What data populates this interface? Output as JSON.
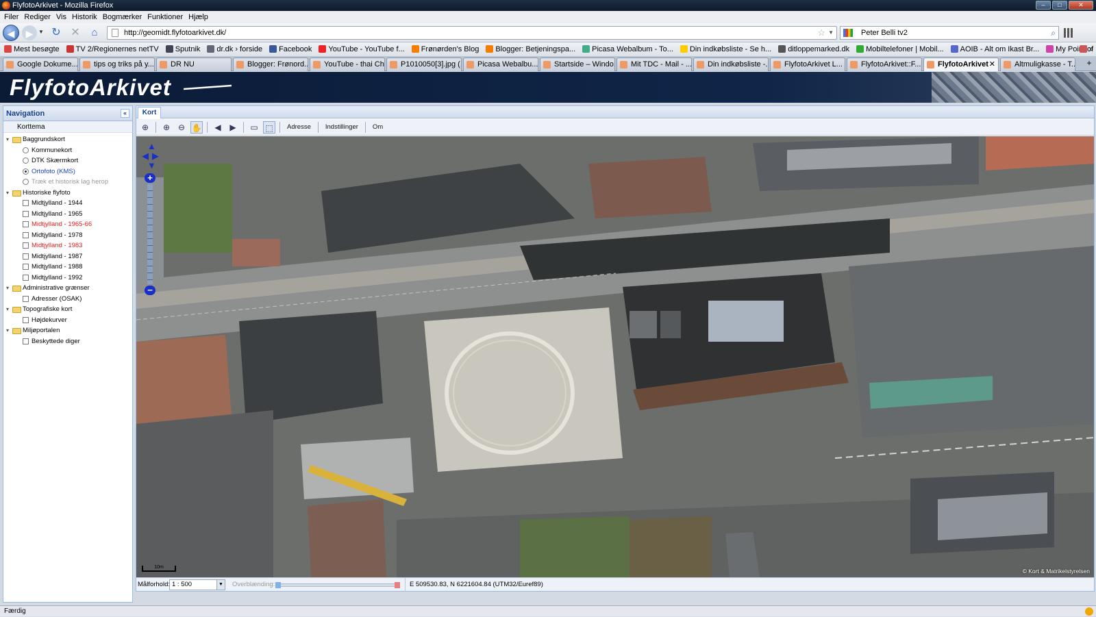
{
  "window": {
    "title": "FlyfotoArkivet - Mozilla Firefox"
  },
  "menu": [
    "Filer",
    "Rediger",
    "Vis",
    "Historik",
    "Bogmærker",
    "Funktioner",
    "Hjælp"
  ],
  "navigation": {
    "url": "http://geomidt.flyfotoarkivet.dk/",
    "search_value": "Peter Belli tv2"
  },
  "bookmarks": [
    "Mest besøgte",
    "TV 2/Regionernes netTV",
    "Sputnik",
    "dr.dk › forside",
    "Facebook",
    "YouTube - YouTube f...",
    "Frønørden's Blog",
    "Blogger: Betjeningspa...",
    "Picasa Webalbum - To...",
    "Din indkøbsliste - Se h...",
    "ditloppemarked.dk",
    "Mobiltelefoner | Mobil...",
    "AOIB - Alt om Ikast Br...",
    "My Point of Interest List"
  ],
  "tabs": [
    "Google Dokume...",
    "tips og triks på y...",
    "DR NU",
    "Blogger: Frønord...",
    "YouTube - thai Chi",
    "P1010050[3].jpg (...",
    "Picasa Webalbu...",
    "Startside – Windo...",
    "Mit TDC - Mail - ...",
    "Din indkøbsliste -...",
    "FlyfotoArkivet L...",
    "FlyfotoArkivet::F...",
    "FlyfotoArkivet",
    "Altmuligkasse - T..."
  ],
  "active_tab_index": 12,
  "site": {
    "logo": "FlyfotoArkivet"
  },
  "nav_panel": {
    "title": "Navigation",
    "korttema": "Korttema",
    "tree": [
      {
        "type": "folder",
        "label": "Baggrundskort"
      },
      {
        "type": "radio",
        "label": "Kommunekort",
        "checked": false,
        "style": ""
      },
      {
        "type": "radio",
        "label": "DTK Skærmkort",
        "checked": false,
        "style": ""
      },
      {
        "type": "radio",
        "label": "Ortofoto (KMS)",
        "checked": true,
        "style": "blue"
      },
      {
        "type": "radio",
        "label": "Træk et historisk lag herop",
        "checked": false,
        "style": "dim"
      },
      {
        "type": "folder",
        "label": "Historiske flyfoto"
      },
      {
        "type": "check",
        "label": "Midtjylland - 1944",
        "style": ""
      },
      {
        "type": "check",
        "label": "Midtjylland - 1965",
        "style": ""
      },
      {
        "type": "check",
        "label": "Midtjylland - 1965-66",
        "style": "red"
      },
      {
        "type": "check",
        "label": "Midtjylland - 1978",
        "style": ""
      },
      {
        "type": "check",
        "label": "Midtjylland - 1983",
        "style": "red"
      },
      {
        "type": "check",
        "label": "Midtjylland - 1987",
        "style": ""
      },
      {
        "type": "check",
        "label": "Midtjylland - 1988",
        "style": ""
      },
      {
        "type": "check",
        "label": "Midtjylland - 1992",
        "style": ""
      },
      {
        "type": "folder",
        "label": "Administrative grænser"
      },
      {
        "type": "check",
        "label": "Adresser (OSAK)",
        "style": ""
      },
      {
        "type": "folder",
        "label": "Topografiske kort"
      },
      {
        "type": "check",
        "label": "Højdekurver",
        "style": ""
      },
      {
        "type": "folder",
        "label": "Miljøportalen"
      },
      {
        "type": "check",
        "label": "Beskyttede diger",
        "style": ""
      }
    ]
  },
  "map_panel": {
    "tab": "Kort",
    "toolbar": {
      "address": "Adresse",
      "settings": "Indstillinger",
      "about": "Om"
    },
    "scalebar": "10m",
    "copyright": "© Kort & Matrikelstyrelsen",
    "status": {
      "scale_label": "Målforhold:",
      "scale_value": "1 : 500",
      "overlay_label": "Overblænding:",
      "coords": "E 509530.83, N 6221604.84 (UTM32/Euref89)"
    }
  },
  "statusbar": {
    "text": "Færdig"
  },
  "colors": {
    "title_bar": "#0c1a2b",
    "site_header": "#102548",
    "panel_border": "#99bbe8",
    "map_controls": "#1a2ec8",
    "active_layer": "#1a3fc4",
    "highlight_layer": "#e02020"
  }
}
